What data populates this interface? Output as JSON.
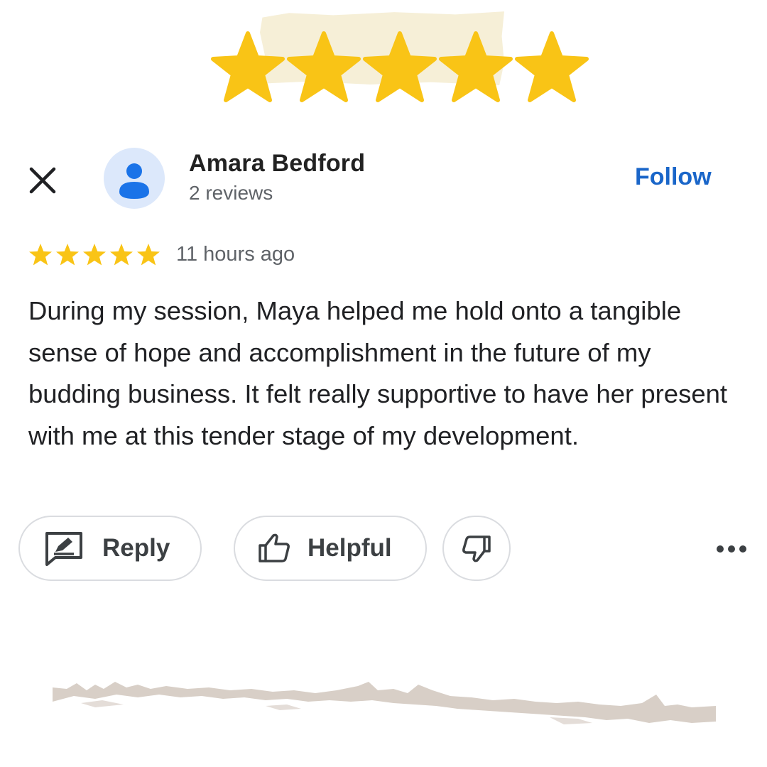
{
  "decoration": {
    "rating": 5,
    "max_rating": 5,
    "star_color": "#f9c416",
    "tape_color": "#f6eed5",
    "scribble_color": "#d8cfc7"
  },
  "reviewer": {
    "name": "Amara Bedford",
    "review_count": "2 reviews",
    "avatar_icon": "person-icon",
    "avatar_bg": "#dce8fb",
    "avatar_fg": "#1a73e8"
  },
  "header": {
    "close_icon": "close-icon",
    "follow_label": "Follow",
    "follow_color": "#1a66c9"
  },
  "review": {
    "rating": 5,
    "time": "11 hours ago",
    "text": "During my session, Maya helped me hold onto a tangible sense of hope and accomplishment in the future of my budding business. It felt really supportive to have her present with me at this tender stage of my development."
  },
  "actions": {
    "reply_label": "Reply",
    "reply_icon": "reply-icon",
    "helpful_label": "Helpful",
    "helpful_icon": "thumbs-up-icon",
    "dislike_icon": "thumbs-down-icon",
    "more_icon": "more-icon"
  }
}
